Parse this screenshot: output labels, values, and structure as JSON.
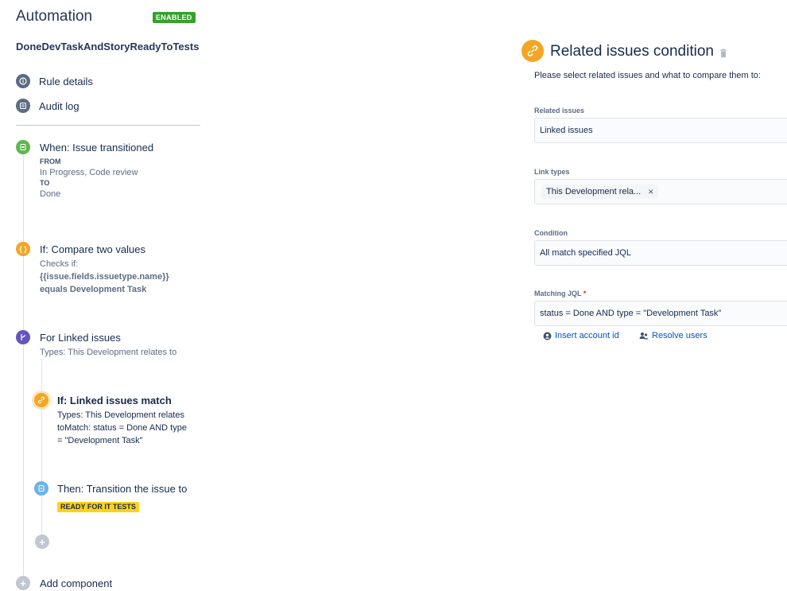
{
  "header": {
    "title": "Automation",
    "status": "ENABLED",
    "rule_name": "DoneDevTaskAndStoryReadyToTests"
  },
  "nav": {
    "rule_details": "Rule details",
    "audit_log": "Audit log"
  },
  "steps": {
    "trigger": {
      "title": "When: Issue transitioned",
      "from_label": "FROM",
      "from_value": "In Progress, Code review",
      "to_label": "TO",
      "to_value": "Done"
    },
    "compare": {
      "title": "If: Compare two values",
      "line1": "Checks if:",
      "line2": "{{issue.fields.issuetype.name}}",
      "line3": "equals Development Task"
    },
    "branch": {
      "title": "For Linked issues",
      "subtitle": "Types: This Development relates to"
    },
    "linked_match": {
      "title": "If: Linked issues match",
      "line1": "Types: This Development relates",
      "line2": "toMatch: status = Done AND type",
      "line3": "= \"Development Task\""
    },
    "transition": {
      "title": "Then: Transition the issue to",
      "status": "READY FOR IT TESTS"
    },
    "add_component": "Add component"
  },
  "panel": {
    "title": "Related issues condition",
    "description": "Please select related issues and what to compare them to:",
    "related_issues": {
      "label": "Related issues",
      "value": "Linked issues"
    },
    "link_types": {
      "label": "Link types",
      "chip": "This Development rela...",
      "remove": "×"
    },
    "condition": {
      "label": "Condition",
      "value": "All match specified JQL"
    },
    "jql": {
      "label": "Matching JQL",
      "required": "*",
      "value": "status = Done AND type = \"Development Task\""
    },
    "actions": {
      "insert_account": "Insert account id",
      "resolve_users": "Resolve users"
    }
  },
  "colors": {
    "enabled": "#36a12c",
    "trigger": "#5fb64d",
    "condition": "#f3a623",
    "branch": "#6554c0",
    "action": "#6cb2e8",
    "status_lozenge": "#ffd11a",
    "link": "#0052cc"
  }
}
